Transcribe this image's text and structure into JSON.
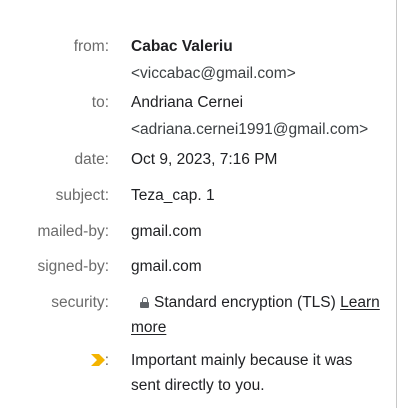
{
  "header": {
    "from": {
      "label": "from:",
      "name": "Cabac Valeriu",
      "email": "<viccabac@gmail.com>"
    },
    "to": {
      "label": "to:",
      "name": "Andriana Cernei",
      "email": "<adriana.cernei1991@gmail.com>"
    },
    "date": {
      "label": "date:",
      "value": "Oct 9, 2023, 7:16 PM"
    },
    "subject": {
      "label": "subject:",
      "value": "Teza_cap. 1"
    },
    "mailed_by": {
      "label": "mailed-by:",
      "value": "gmail.com"
    },
    "signed_by": {
      "label": "signed-by:",
      "value": "gmail.com"
    },
    "security": {
      "label": "security:",
      "value": "Standard encryption (TLS)",
      "link_line1": "Learn",
      "link_line2": "more",
      "icon": "lock-icon"
    },
    "importance": {
      "label": ":",
      "text_line1": "Important mainly because it was",
      "text_line2": "sent directly to you.",
      "icon": "importance-marker-icon",
      "icon_color": "#f4b400"
    }
  },
  "colors": {
    "label": "#6b6b6b",
    "value": "#202124",
    "divider": "#c8c8c8"
  }
}
